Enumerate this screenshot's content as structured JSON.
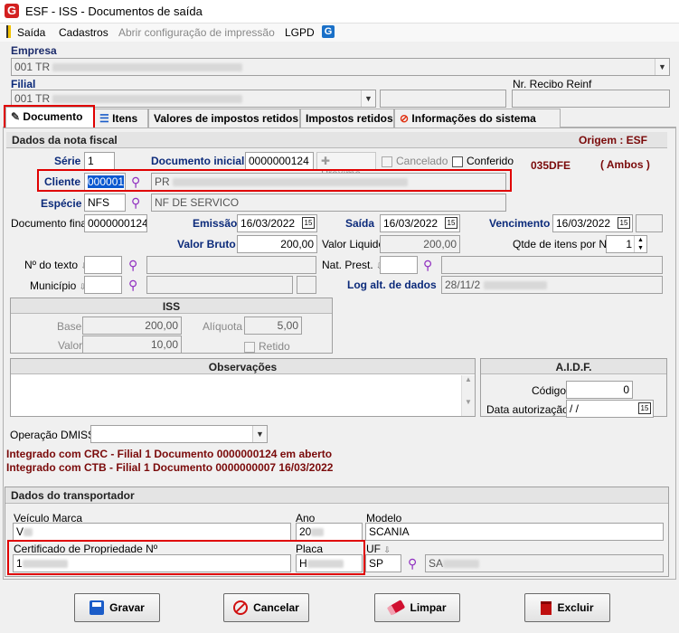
{
  "window": {
    "title": "ESF - ISS - Documentos de saída",
    "logo_letter": "G"
  },
  "menu": {
    "saida": "Saída",
    "cadastros": "Cadastros",
    "abrir_config": "Abrir configuração de impressão",
    "lgpd": "LGPD"
  },
  "header": {
    "empresa_label": "Empresa",
    "empresa_value": "001 TR",
    "filial_label": "Filial",
    "filial_value": "001 TR",
    "recibo_label": "Nr. Recibo Reinf"
  },
  "tabs": [
    {
      "label": "Documento",
      "icon": "pencil-icon"
    },
    {
      "label": "Itens",
      "icon": "edit-list-icon"
    },
    {
      "label": "Valores de impostos retidos"
    },
    {
      "label": "Impostos retidos"
    },
    {
      "label": "Informações do sistema",
      "icon": "system-info-icon"
    }
  ],
  "nota": {
    "section_title": "Dados da nota fiscal",
    "origem": "Origem : ESF",
    "serie_label": "Série",
    "serie_value": "1",
    "doc_inicial_label": "Documento inicial",
    "doc_inicial_value": "0000000124",
    "proximo": "Próximo",
    "cancelado": "Cancelado",
    "conferido": "Conferido",
    "code_035": "035DFE",
    "ambos": "( Ambos )",
    "cliente_label": "Cliente",
    "cliente_code": "000001",
    "cliente_name": "PR",
    "especie_label": "Espécie",
    "especie_code": "NFS",
    "especie_desc": "NF DE SERVICO",
    "doc_final_label": "Documento final",
    "doc_final_value": "0000000124",
    "emissao_label": "Emissão",
    "emissao_value": "16/03/2022",
    "saida_label": "Saída",
    "saida_value": "16/03/2022",
    "vencimento_label": "Vencimento",
    "vencimento_value": "16/03/2022",
    "valor_bruto_label": "Valor Bruto",
    "valor_bruto_value": "200,00",
    "valor_liquido_label": "Valor Liquido",
    "valor_liquido_value": "200,00",
    "qtde_label": "Qtde de itens por NF",
    "qtde_value": "1",
    "n_texto_label": "Nº do texto",
    "nat_prest_label": "Nat. Prest.",
    "municipio_label": "Município",
    "log_label": "Log alt. de dados",
    "log_value": "28/11/2"
  },
  "iss": {
    "title": "ISS",
    "base_label": "Base",
    "base_value": "200,00",
    "aliquota_label": "Alíquota",
    "aliquota_value": "5,00",
    "valor_label": "Valor",
    "valor_value": "10,00",
    "retido_label": "Retido"
  },
  "obs": {
    "title": "Observações"
  },
  "aidf": {
    "title": "A.I.D.F.",
    "codigo_label": "Código",
    "codigo_value": "0",
    "data_label": "Data autorização",
    "data_value": " / /"
  },
  "dmiss": {
    "label": "Operação DMISS"
  },
  "integracao": [
    "Integrado com CRC - Filial 1 Documento 0000000124 em aberto",
    "Integrado com CTB - Filial 1 Documento 0000000007 16/03/2022"
  ],
  "transportador": {
    "section_title": "Dados do transportador",
    "veiculo_label": "Veículo Marca",
    "veiculo_value": "V",
    "ano_label": "Ano",
    "ano_value": "20",
    "modelo_label": "Modelo",
    "modelo_value": "SCANIA",
    "cert_label": "Certificado de Propriedade Nº",
    "cert_value": "1",
    "placa_label": "Placa",
    "placa_value": "H",
    "uf_label": "UF",
    "uf_value": "SP",
    "cidade_value": "SA"
  },
  "buttons": {
    "gravar": "Gravar",
    "cancelar": "Cancelar",
    "limpar": "Limpar",
    "excluir": "Excluir"
  },
  "colors": {
    "accent_red": "#e00000",
    "label_blue": "#0b2a7a",
    "maroon": "#7a0a0a"
  }
}
